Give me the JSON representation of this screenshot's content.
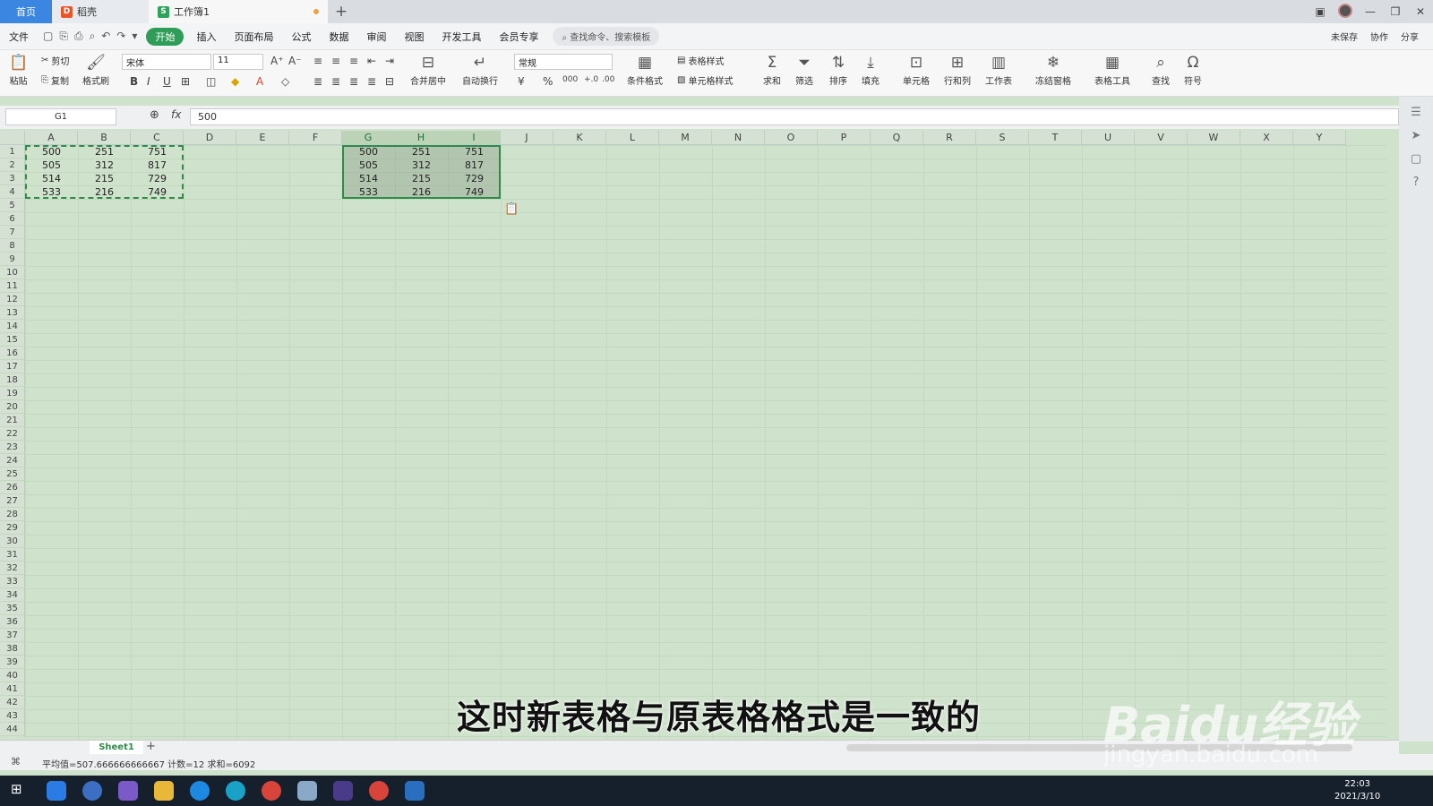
{
  "tabs": [
    {
      "label": "首页"
    },
    {
      "label": "稻壳"
    },
    {
      "label": "工作簿1"
    }
  ],
  "menu": [
    "文件",
    "开始",
    "插入",
    "页面布局",
    "公式",
    "数据",
    "审阅",
    "视图",
    "开发工具",
    "会员专享"
  ],
  "search_cmd": "查找命令、搜索模板",
  "menu_right": [
    "未保存",
    "协作",
    "分享"
  ],
  "ribbon": {
    "paste": "粘贴",
    "cut": "剪切",
    "copy": "复制",
    "format_painter": "格式刷",
    "font": "宋体",
    "font_size": "11",
    "merge": "合并居中",
    "wrap": "自动换行",
    "number_format": "常规",
    "cond_format": "条件格式",
    "table_style": "表格样式",
    "cell_style": "单元格样式",
    "sum": "求和",
    "filter": "筛选",
    "sort": "排序",
    "fill": "填充",
    "cells": "单元格",
    "rowcol": "行和列",
    "worksheet": "工作表",
    "freeze": "冻结窗格",
    "table_tools": "表格工具",
    "find": "查找",
    "symbol": "符号"
  },
  "name_box": "G1",
  "formula_value": "500",
  "columns": [
    "A",
    "B",
    "C",
    "D",
    "E",
    "F",
    "G",
    "H",
    "I",
    "J",
    "K",
    "L",
    "M",
    "N",
    "O",
    "P",
    "Q",
    "R",
    "S",
    "T",
    "U",
    "V",
    "W",
    "X",
    "Y"
  ],
  "rows": [
    1,
    2,
    3,
    4,
    5,
    6,
    7,
    8,
    9,
    10,
    11,
    12,
    13,
    14,
    15,
    16,
    17,
    18,
    19,
    20,
    21,
    22,
    23,
    24,
    25,
    26,
    27,
    28,
    29,
    30,
    31,
    32,
    33,
    34,
    35,
    36,
    37,
    38,
    39,
    40,
    41,
    42,
    43,
    44
  ],
  "source_table": [
    [
      "500",
      "251",
      "751"
    ],
    [
      "505",
      "312",
      "817"
    ],
    [
      "514",
      "215",
      "729"
    ],
    [
      "533",
      "216",
      "749"
    ]
  ],
  "pasted_table": [
    [
      "500",
      "251",
      "751"
    ],
    [
      "505",
      "312",
      "817"
    ],
    [
      "514",
      "215",
      "729"
    ],
    [
      "533",
      "216",
      "749"
    ]
  ],
  "sheet_tab": "Sheet1",
  "status": "平均值=507.666666666667  计数=12  求和=6092",
  "subtitle": "这时新表格与原表格格式是一致的",
  "watermark": "Baidu经验",
  "watermark_url": "jingyan.baidu.com",
  "clock": {
    "time": "22:03",
    "date": "2021/3/10"
  },
  "accent": "#2e9d57"
}
